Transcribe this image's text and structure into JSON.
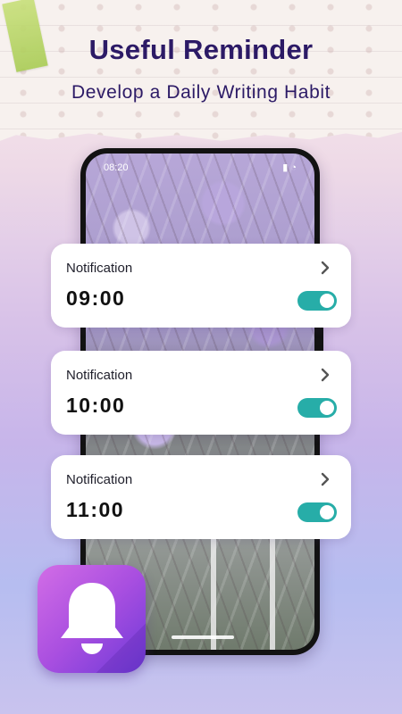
{
  "header": {
    "title": "Useful Reminder",
    "subtitle": "Develop a Daily Writing Habit"
  },
  "phone": {
    "status_time": "08:20"
  },
  "reminders": [
    {
      "label": "Notification",
      "time": "09:00",
      "enabled": true
    },
    {
      "label": "Notification",
      "time": "10:00",
      "enabled": true
    },
    {
      "label": "Notification",
      "time": "11:00",
      "enabled": true
    }
  ],
  "colors": {
    "title": "#2c1a66",
    "toggle_on": "#27ada8",
    "icon_gradient_start": "#d26de6",
    "icon_gradient_end": "#6e3ad8"
  },
  "icons": {
    "chevron": "chevron-right-icon",
    "app": "bell-icon"
  }
}
